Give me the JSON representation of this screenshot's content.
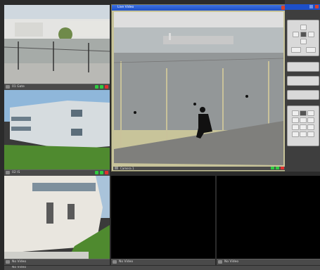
{
  "tiles": {
    "t1": {
      "label": "01 Gate"
    },
    "t2": {
      "label": "02 IS"
    },
    "t3": {
      "label": "No Video"
    },
    "t4": {
      "label": "No Video"
    },
    "t5": {
      "label": "No Video"
    },
    "t6": {
      "label": "No Video"
    }
  },
  "main": {
    "title": "Live Video",
    "label": "Camera 1"
  },
  "colors": {
    "status_ok": "#2ecc40",
    "status_alert": "#e0302e",
    "title_blue": "#1d4fc9"
  }
}
